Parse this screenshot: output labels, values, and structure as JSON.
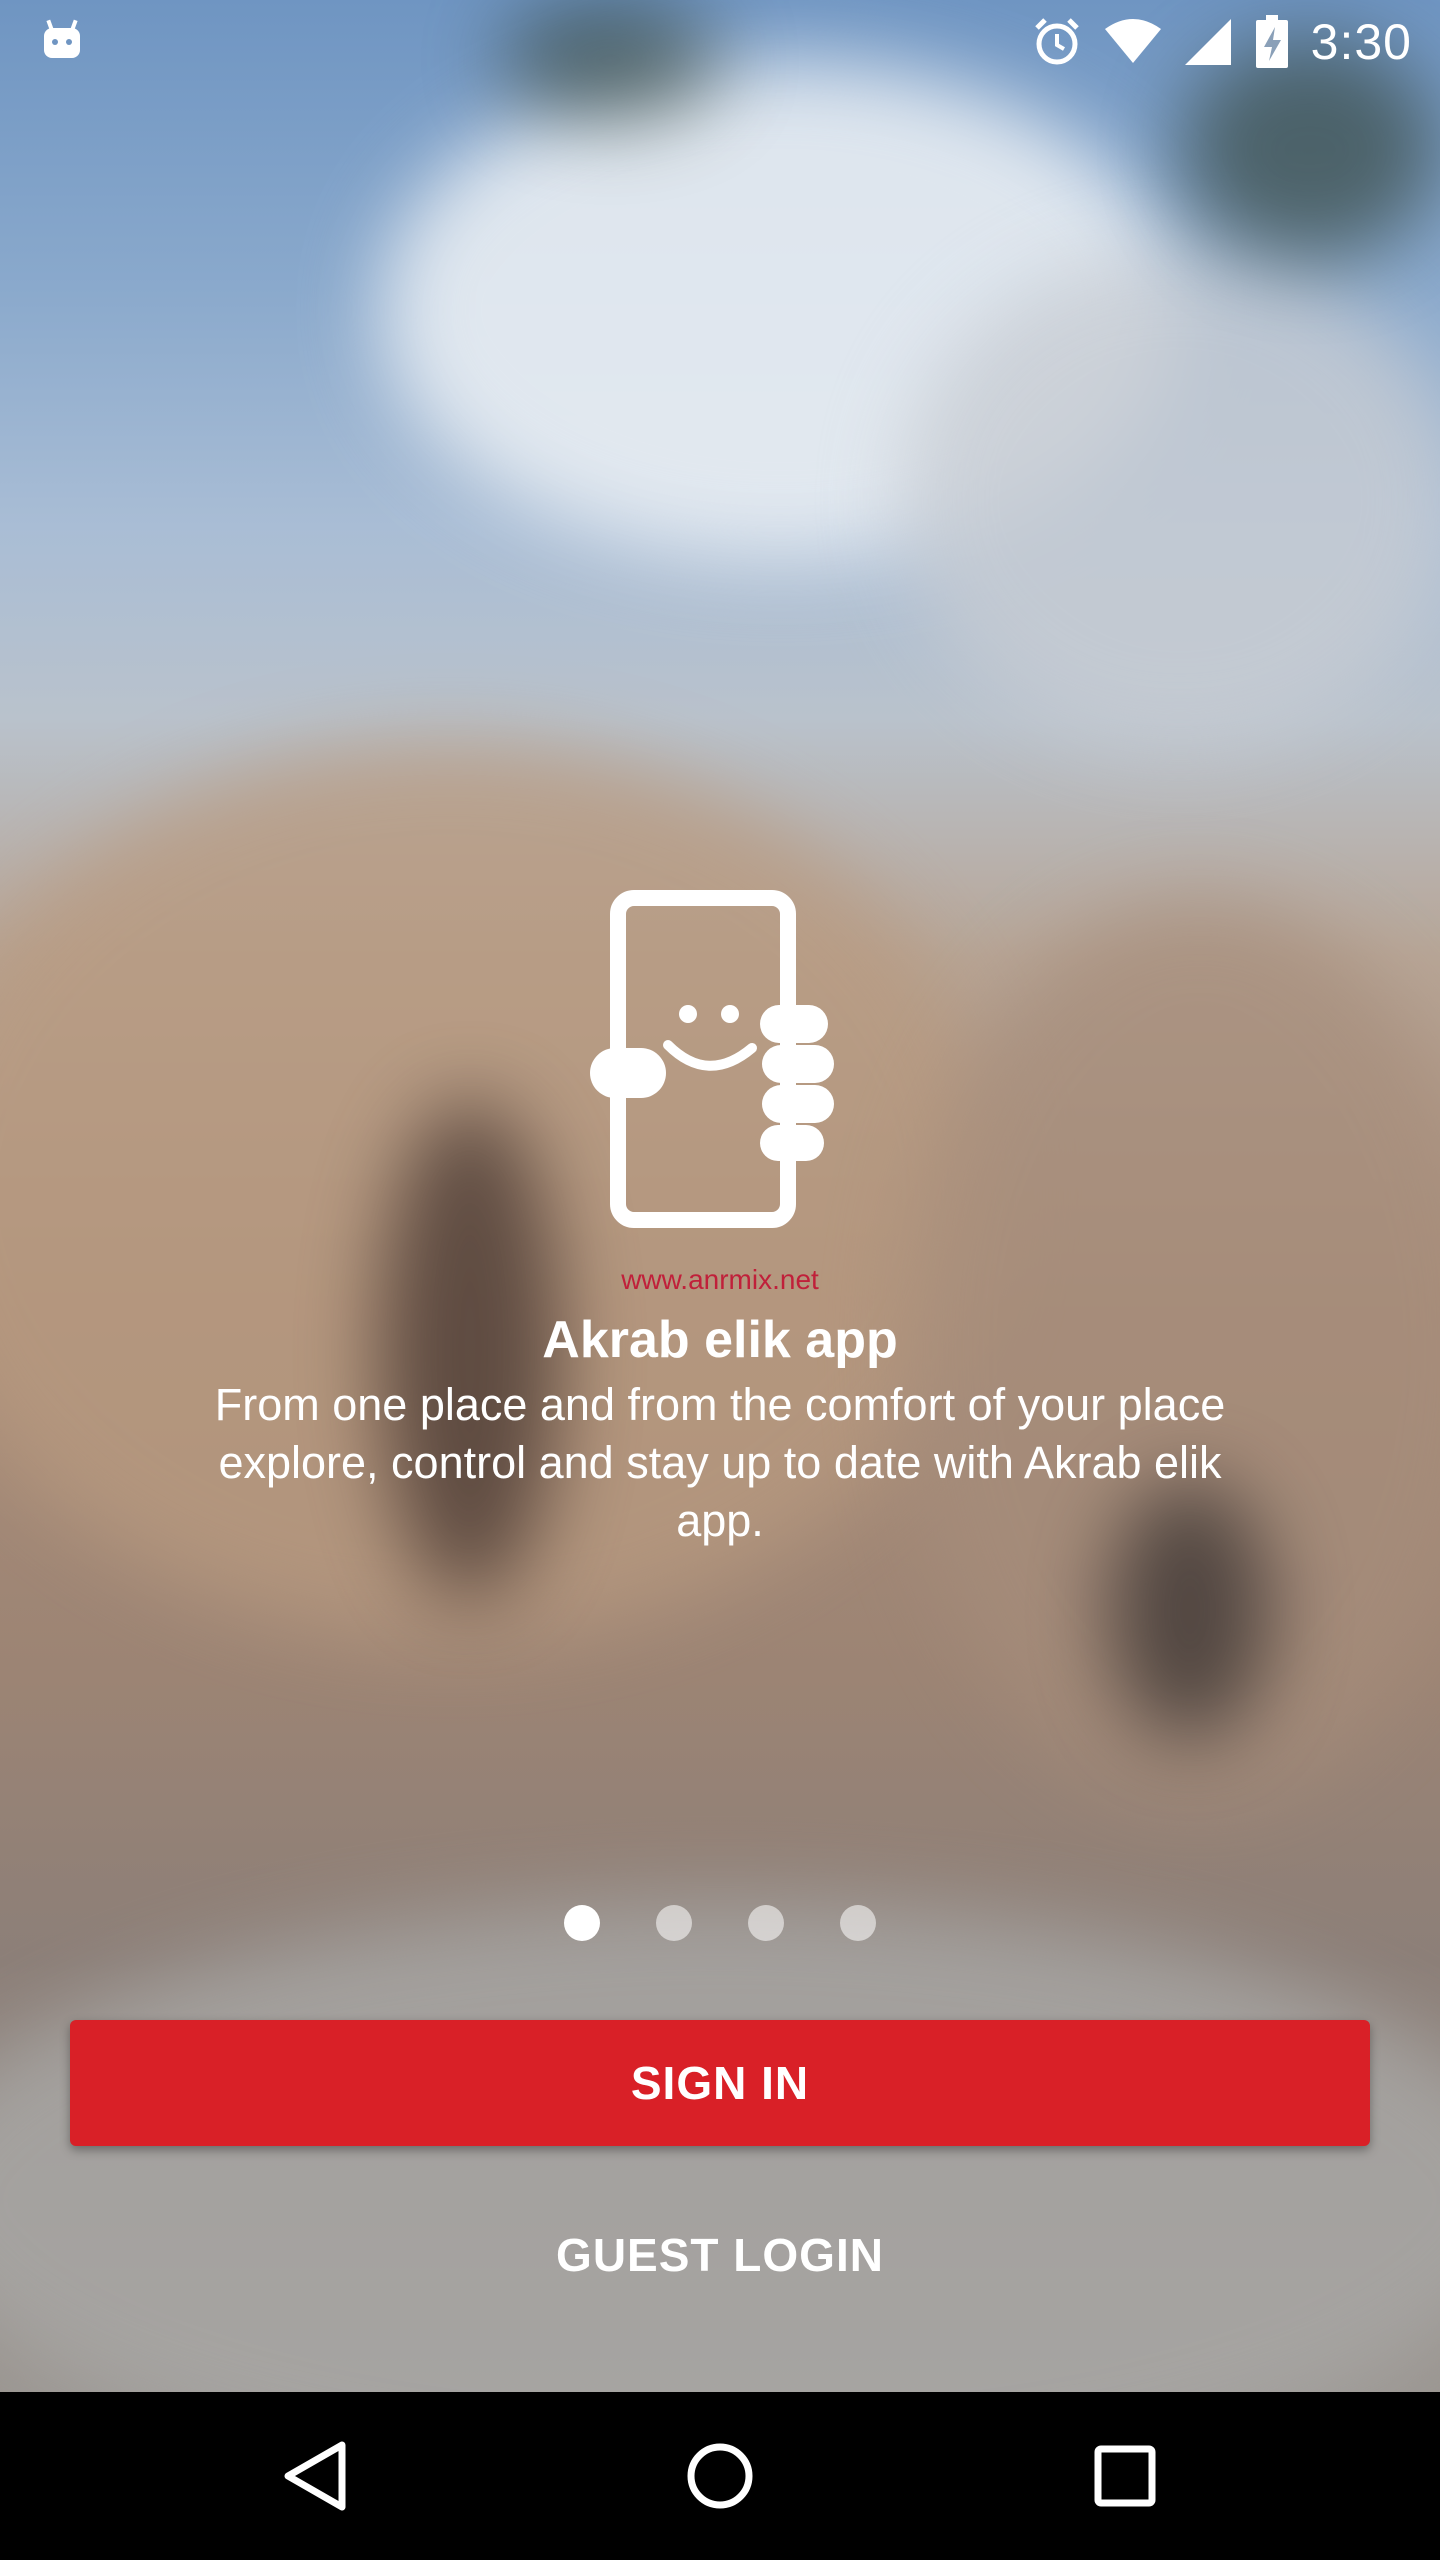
{
  "status_bar": {
    "time": "3:30",
    "icons": [
      "android-debug-icon",
      "alarm-icon",
      "wifi-icon",
      "signal-icon",
      "battery-charging-icon"
    ]
  },
  "intro": {
    "icon": "phone-smiley-icon",
    "watermark": "www.anrmix.net",
    "title": "Akrab elik app",
    "description": "From one place and from the comfort of your place explore, control and stay up to date with Akrab elik app."
  },
  "pager": {
    "total": 4,
    "active_index": 0
  },
  "actions": {
    "sign_in_label": "SIGN IN",
    "guest_login_label": "GUEST LOGIN"
  },
  "colors": {
    "primary": "#d92027",
    "nav_bar": "#000000",
    "text": "#ffffff"
  },
  "nav_bar": {
    "buttons": [
      "back-icon",
      "home-icon",
      "recents-icon"
    ]
  }
}
